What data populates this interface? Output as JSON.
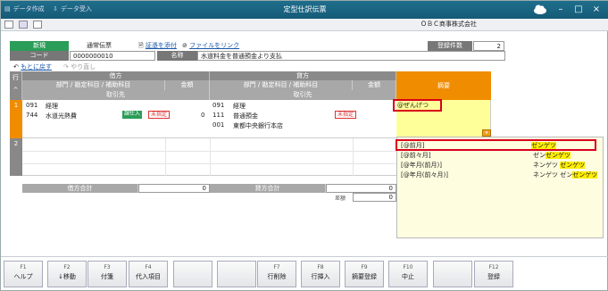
{
  "window": {
    "title": "定型仕訳伝票"
  },
  "toolbar": {
    "data_create": "データ作成",
    "data_receive": "データ受入",
    "company": "ＯＢＣ商事株式会社"
  },
  "header": {
    "new_label": "新規",
    "voucher_type": "通常伝票",
    "attach_voucher": "証憑を添付",
    "link_file": "ファイルをリンク",
    "code_label": "コード",
    "code_value": "0000000010",
    "name_label": "名称",
    "name_value": "水道料金を普通預金より支払",
    "count_label": "登録件数",
    "count_value": "2"
  },
  "nav": {
    "undo": "もとに戻す",
    "redo": "やり直し"
  },
  "grid": {
    "row_header": "行",
    "debit_label": "借方",
    "credit_label": "貸方",
    "summary_label": "摘要",
    "sub_cols": "部門 / 勘定科目 / 補助科目",
    "amount_label": "金額",
    "partner_label": "取引先",
    "rows": [
      {
        "no": "1",
        "debit_dept_code": "091",
        "debit_dept": "経理",
        "debit_acct_code": "744",
        "debit_acct": "水道光熱費",
        "debit_tax": "課仕入",
        "debit_unset": "未指定",
        "debit_amount": "0",
        "credit_dept_code": "091",
        "credit_dept": "経理",
        "credit_acct_code": "111",
        "credit_acct": "普通預金",
        "credit_sub_code": "001",
        "credit_sub": "東都中央銀行本店",
        "credit_unset": "未指定",
        "summary_input": "@ぜんげつ"
      },
      {
        "no": "2"
      }
    ]
  },
  "totals": {
    "debit_total_label": "借方合計",
    "debit_total": "0",
    "credit_total_label": "貸方合計",
    "credit_total": "0",
    "diff_label": "差額",
    "diff_value": "0"
  },
  "suggestions": [
    {
      "label": "[@前月]",
      "reading": "ゼンゲツ",
      "hl_start": "",
      "hl": "ゼンゲツ"
    },
    {
      "label": "[@前々月]",
      "reading": "ゼンゼンゲツ",
      "hl_start": "ゼン",
      "hl": "ゼンゲツ"
    },
    {
      "label": "[@年月(前月)]",
      "reading": "ネンゲツ ゼンゲツ",
      "hl_start": "ネンゲツ ",
      "hl": "ゼンゲツ"
    },
    {
      "label": "[@年月(前々月)]",
      "reading": "ネンゲツ ゼンゼンゲツ",
      "hl_start": "ネンゲツ ゼン",
      "hl": "ゼンゲツ"
    }
  ],
  "fkeys": [
    {
      "key": "F1",
      "label": "ヘルプ"
    },
    {
      "key": "F2",
      "label": "↓移動"
    },
    {
      "key": "F3",
      "label": "付箋"
    },
    {
      "key": "F4",
      "label": "代入項目"
    },
    {
      "key": "",
      "label": ""
    },
    {
      "key": "",
      "label": ""
    },
    {
      "key": "F7",
      "label": "行削除"
    },
    {
      "key": "F8",
      "label": "行挿入"
    },
    {
      "key": "F9",
      "label": "摘要登録"
    },
    {
      "key": "F10",
      "label": "中止"
    },
    {
      "key": "",
      "label": ""
    },
    {
      "key": "F12",
      "label": "登録"
    }
  ],
  "colors": {
    "titlebar": "#1a6585",
    "summary_col": "#f08c00",
    "active_row": "#ffff99",
    "highlight_border": "#d9001b",
    "new_label": "#2a9d58"
  }
}
